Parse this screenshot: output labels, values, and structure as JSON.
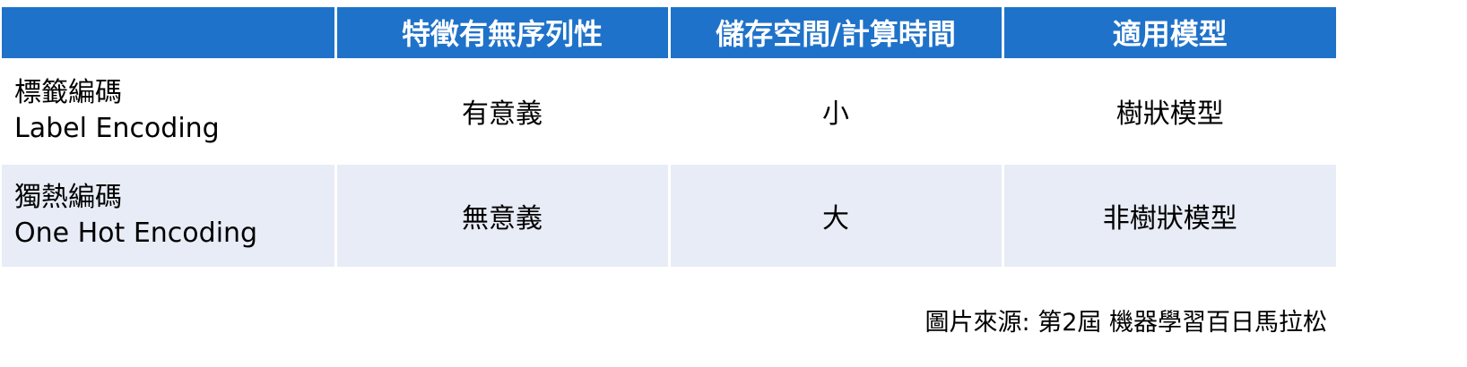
{
  "table": {
    "headers": [
      "",
      "特徵有無序列性",
      "儲存空間/計算時間",
      "適用模型"
    ],
    "rows": [
      {
        "name_zh": "標籤編碼",
        "name_en": "Label Encoding",
        "ordinal": "有意義",
        "cost": "小",
        "model": "樹狀模型"
      },
      {
        "name_zh": "獨熱編碼",
        "name_en": "One Hot Encoding",
        "ordinal": "無意義",
        "cost": "大",
        "model": "非樹狀模型"
      }
    ]
  },
  "caption": "圖片來源: 第2屆 機器學習百日馬拉松",
  "colors": {
    "header_bg": "#1f72c9",
    "header_text": "#ffffff",
    "shaded_row_bg": "#e8ecf6"
  }
}
